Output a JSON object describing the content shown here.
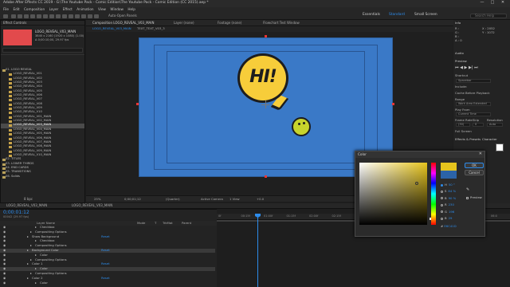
{
  "window": {
    "title": "Adobe After Effects CC 2019 - G:\\The Youtube Pack - Comic Edition\\The Youtube Pack - Comic Edition (CC 2015).aep *",
    "controls": [
      "—",
      "□",
      "✕"
    ]
  },
  "menu": [
    "File",
    "Edit",
    "Composition",
    "Layer",
    "Effect",
    "Animation",
    "View",
    "Window",
    "Help"
  ],
  "workspaces": {
    "items": [
      "Essentials",
      "Standard",
      "Small Screen"
    ],
    "active": "Standard",
    "search_placeholder": "Search Help"
  },
  "toolbar": {
    "auto_open": "Auto-Open Panels"
  },
  "project": {
    "tab_label": "Effect Controls",
    "item_name": "LOGO_REVEAL_V03_MAIN",
    "item_info": "3840 x 2160 (1920 x 1080) (1.00)",
    "item_duration": "Δ 0;00:10;00, 29.97 fps",
    "search_placeholder": "",
    "items": [
      {
        "label": "01. LOGO REVEAL",
        "type": "folder"
      },
      {
        "label": "LOGO_REVEAL_V01",
        "type": "comp"
      },
      {
        "label": "LOGO_REVEAL_V02",
        "type": "comp"
      },
      {
        "label": "LOGO_REVEAL_V03",
        "type": "comp"
      },
      {
        "label": "LOGO_REVEAL_V04",
        "type": "comp"
      },
      {
        "label": "LOGO_REVEAL_V05",
        "type": "comp"
      },
      {
        "label": "LOGO_REVEAL_V06",
        "type": "comp"
      },
      {
        "label": "LOGO_REVEAL_V07",
        "type": "comp"
      },
      {
        "label": "LOGO_REVEAL_V08",
        "type": "comp"
      },
      {
        "label": "LOGO_REVEAL_V09",
        "type": "comp"
      },
      {
        "label": "LOGO_REVEAL_V10",
        "type": "comp"
      },
      {
        "label": "LOGO_REVEAL_V01_MAIN",
        "type": "comp"
      },
      {
        "label": "LOGO_REVEAL_V02_MAIN",
        "type": "comp"
      },
      {
        "label": "LOGO_REVEAL_V03_MAIN",
        "type": "comp",
        "selected": true
      },
      {
        "label": "LOGO_REVEAL_V04_MAIN",
        "type": "comp"
      },
      {
        "label": "LOGO_REVEAL_V05_MAIN",
        "type": "comp"
      },
      {
        "label": "LOGO_REVEAL_V06_MAIN",
        "type": "comp"
      },
      {
        "label": "LOGO_REVEAL_V07_MAIN",
        "type": "comp"
      },
      {
        "label": "LOGO_REVEAL_V08_MAIN",
        "type": "comp"
      },
      {
        "label": "LOGO_REVEAL_V09_MAIN",
        "type": "comp"
      },
      {
        "label": "LOGO_REVEAL_V10_MAIN",
        "type": "comp"
      },
      {
        "label": "02. TITLES",
        "type": "folder"
      },
      {
        "label": "03. LOWER THIRDS",
        "type": "folder"
      },
      {
        "label": "04. END CARDS",
        "type": "folder"
      },
      {
        "label": "05. TRANSITIONS",
        "type": "folder"
      },
      {
        "label": "06. Solids",
        "type": "folder"
      }
    ],
    "bpc": "8 bpc"
  },
  "composition": {
    "tab_label": "Composition LOGO_REVEAL_V03_MAIN",
    "tabs": [
      "Layer (none)",
      "Footage (none)",
      "Flowchart Test Window"
    ],
    "breadcrumb": [
      "LOGO_REVEAL_V03_MAIN",
      "TEXT_TEXT_V03_3"
    ],
    "text": "HI!",
    "colors": {
      "background": "#3a79c7",
      "bubble": "#f7cd3a",
      "ball": "#c7d42c"
    },
    "view_bar": {
      "zoom": "25%",
      "timecode": "0;00;01;12",
      "resolution": "(Quarter)",
      "camera": "Active Camera",
      "views": "1 View",
      "offset": "+0.0"
    }
  },
  "right_panel": {
    "sections": [
      "Info",
      "Audio",
      "Preview",
      "Effects & Presets",
      "Character",
      "Paragraph"
    ],
    "preview": {
      "shortcut_label": "Shortcut",
      "shortcut": "Spacebar",
      "include": "Include:",
      "cache_before_playback": "Cache Before Playback",
      "range_label": "Range",
      "range": "Work Area Extended",
      "play_from_label": "Play From",
      "play_from": "Current Time",
      "frame_rate_label": "Frame Rate",
      "skip_label": "Skip",
      "resolution_label": "Resolution",
      "frame_rate": "(30)",
      "skip": "0",
      "resolution": "Auto",
      "full_screen": "Full Screen"
    },
    "info": {
      "r": "R :",
      "g": "G :",
      "b": "B :",
      "a": "A : 0",
      "x": "X : 2052",
      "y": "Y : 1072"
    }
  },
  "timeline": {
    "tabs": [
      "LOGO_REVEAL_V03_MAIN",
      "LOGO_REVEAL_V03_MAIN"
    ],
    "timecode": "0;00:01:12",
    "fps_info": "00042 (29.97 fps)",
    "header": [
      "Layer Name",
      "Mode",
      "T",
      "TrkMat",
      "Parent"
    ],
    "rows": [
      {
        "label": "Checkbox",
        "value": "",
        "indent": 50
      },
      {
        "label": "Compositing Options",
        "value": "",
        "indent": 44
      },
      {
        "label": "Show Background",
        "value": "Reset",
        "indent": 40
      },
      {
        "label": "Checkbox",
        "value": "",
        "indent": 50
      },
      {
        "label": "Compositing Options",
        "value": "",
        "indent": 44
      },
      {
        "label": "Background Color",
        "value": "Reset",
        "indent": 40,
        "selected": true
      },
      {
        "label": "Color",
        "value": "",
        "indent": 50
      },
      {
        "label": "Compositing Options",
        "value": "",
        "indent": 44
      },
      {
        "label": "Color 1",
        "value": "Reset",
        "indent": 40
      },
      {
        "label": "Color",
        "value": "",
        "indent": 50,
        "selected": true
      },
      {
        "label": "Compositing Options",
        "value": "",
        "indent": 44
      },
      {
        "label": "Color 2",
        "value": "Reset",
        "indent": 40
      },
      {
        "label": "Color",
        "value": "",
        "indent": 50
      }
    ],
    "ruler": [
      "0f",
      "00:15f",
      "01:00f",
      "01:15f",
      "02:00f",
      "02:15f",
      "03:00f",
      "03:15f",
      "04:00f",
      "04:15f",
      "05:00f",
      "05:15f",
      "06:0"
    ],
    "mode_label": "Normal",
    "parent_label": "None"
  },
  "color_dialog": {
    "title": "Color",
    "ok_label": "OK",
    "cancel_label": "Cancel",
    "preview_label": "Preview",
    "new_color": "#e6c41d",
    "old_color": "#2b63a8",
    "fields": [
      {
        "label": "H",
        "value": "50 °",
        "selected": true
      },
      {
        "label": "S",
        "value": "84 %"
      },
      {
        "label": "B",
        "value": "90 %"
      },
      {
        "label": "R",
        "value": "230"
      },
      {
        "label": "G",
        "value": "196"
      },
      {
        "label": "B",
        "value": "29"
      }
    ],
    "hex_label": "#",
    "hex_value": "E6C41D"
  }
}
